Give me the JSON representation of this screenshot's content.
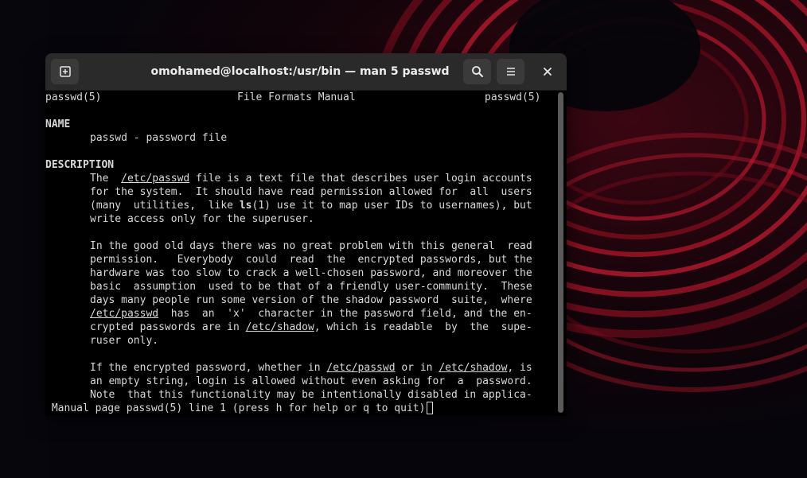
{
  "window": {
    "title": "omohamed@localhost:/usr/bin — man 5 passwd"
  },
  "header": {
    "left": "passwd(5)",
    "center": "File Formats Manual",
    "right": "passwd(5)"
  },
  "man": {
    "name_heading": "NAME",
    "name_line": "passwd - password file",
    "desc_heading": "DESCRIPTION",
    "p1": {
      "l1a": "The  ",
      "l1b": "/etc/passwd",
      "l1c": " file is a text file that describes user login accounts",
      "l2": "for the system.  It should have read permission allowed for  all  users",
      "l3a": "(many  utilities,  like ",
      "l3b": "ls",
      "l3c": "(1) use it to map user IDs to usernames), but",
      "l4": "write access only for the superuser."
    },
    "p2": {
      "l1": "In the good old days there was no great problem with this general  read",
      "l2": "permission.   Everybody  could  read  the  encrypted passwords, but the",
      "l3": "hardware was too slow to crack a well-chosen password, and moreover the",
      "l4": "basic  assumption  used to be that of a friendly user-community.  These",
      "l5": "days many people run some version of the shadow password  suite,  where",
      "l6a": "/etc/passwd",
      "l6b": "  has  an  'x'  character in the password field, and the en-",
      "l7a": "crypted passwords are in ",
      "l7b": "/etc/shadow",
      "l7c": ", which is readable  by  the  supe-",
      "l8": "ruser only."
    },
    "p3": {
      "l1a": "If the encrypted password, whether in ",
      "l1b": "/etc/passwd",
      "l1c": " or in ",
      "l1d": "/etc/shadow",
      "l1e": ", is",
      "l2": "an empty string, login is allowed without even asking for  a  password.",
      "l3": "Note  that this functionality may be intentionally disabled in applica-"
    }
  },
  "status": {
    "text": " Manual page passwd(5) line 1 (press h for help or q to quit)"
  },
  "icons": {
    "new_tab": "new-tab-icon",
    "search": "search-icon",
    "menu": "hamburger-menu-icon",
    "close": "close-icon"
  }
}
